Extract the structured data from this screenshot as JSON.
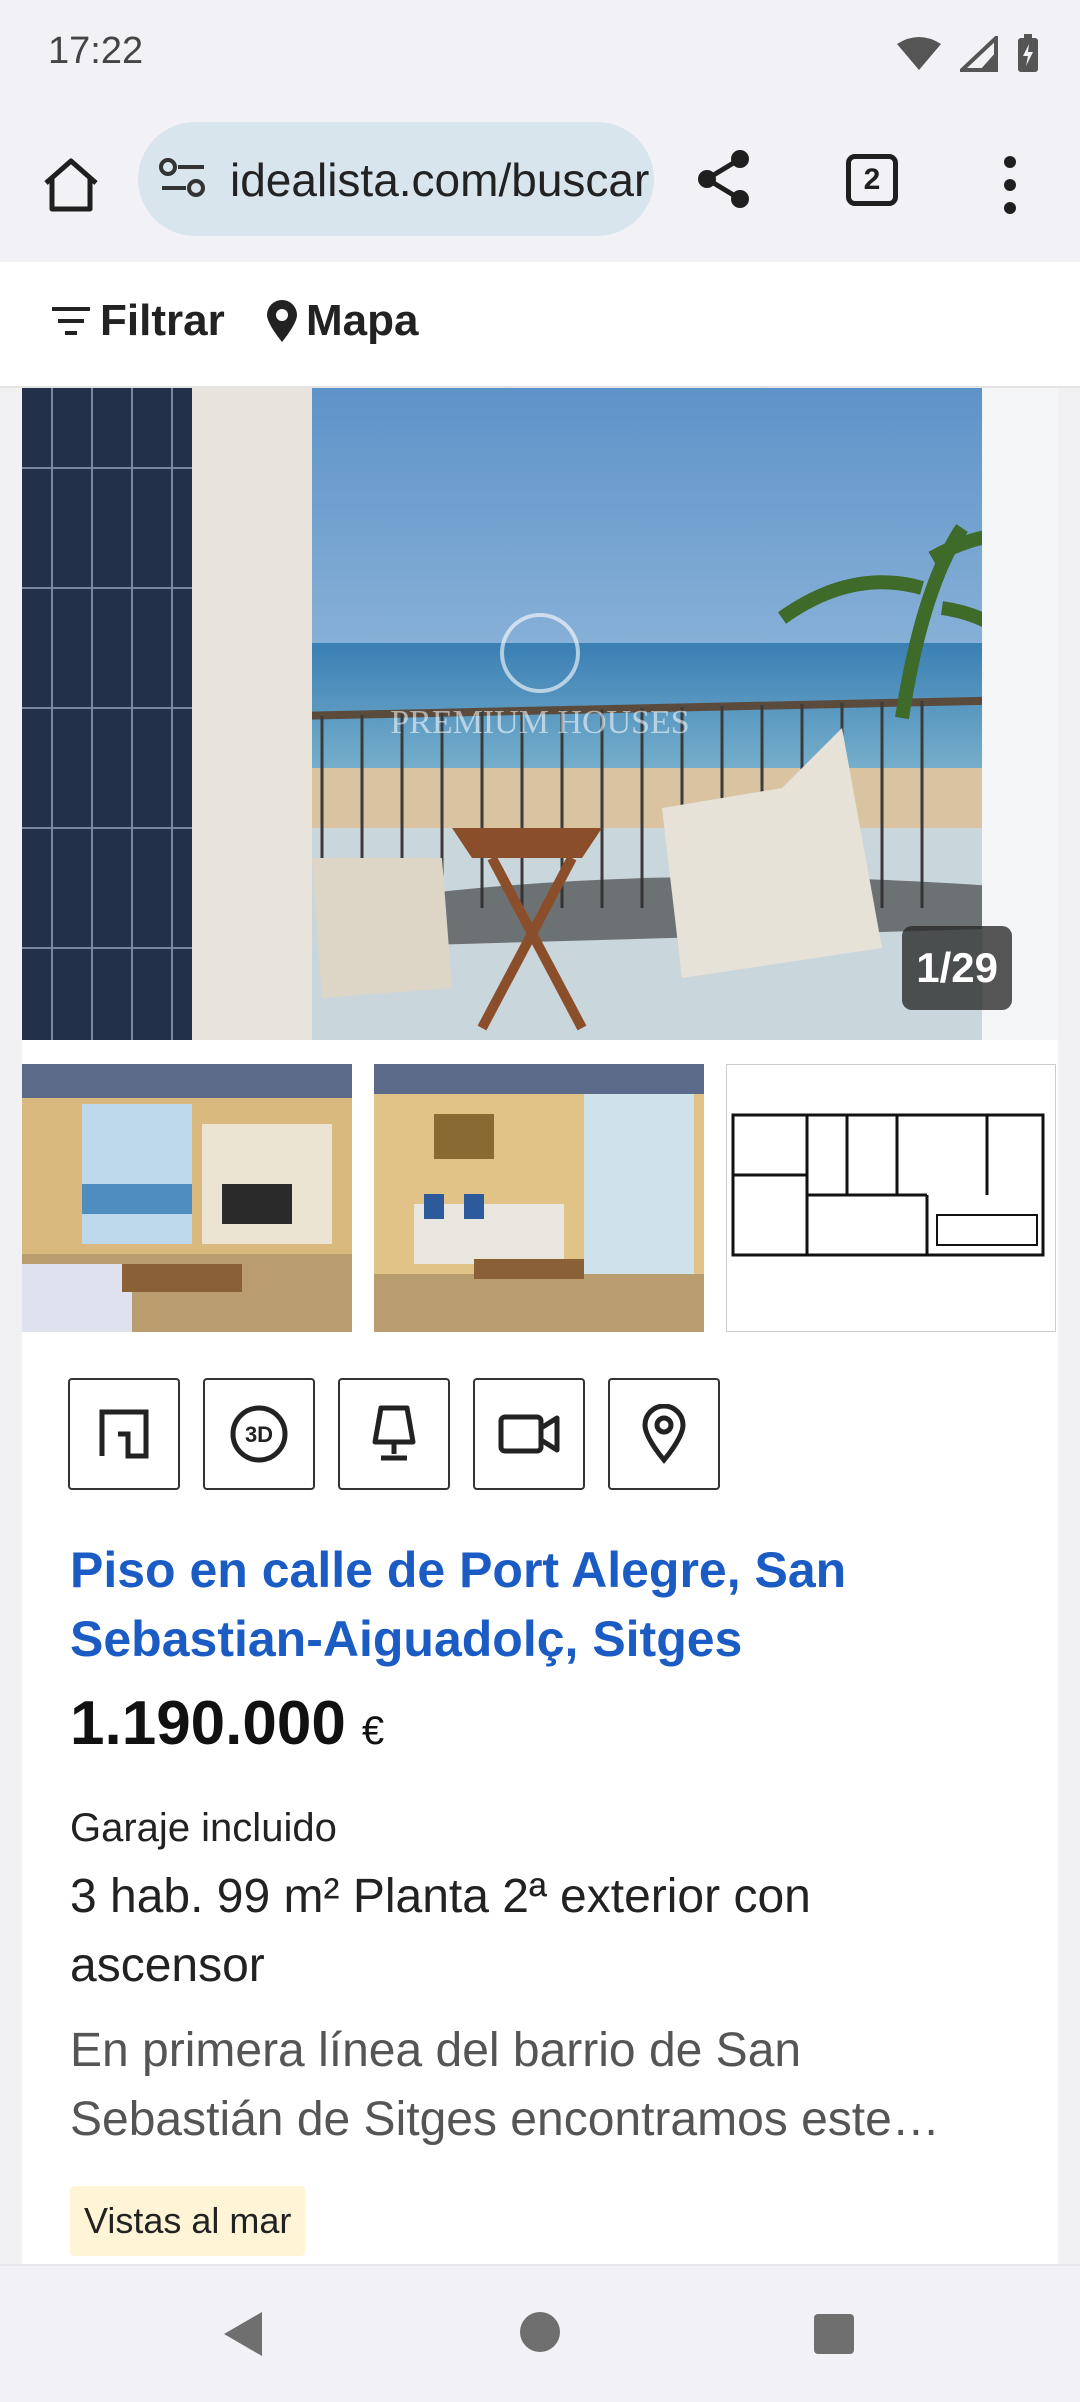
{
  "status": {
    "time": "17:22"
  },
  "browser": {
    "url": "idealista.com/buscar",
    "tab_count": "2"
  },
  "filterbar": {
    "filter_label": "Filtrar",
    "map_label": "Mapa"
  },
  "listing": {
    "photo_counter": "1/29",
    "watermark": "PREMIUM HOUSES",
    "features": [
      "floor-plan-icon",
      "3d-tour-icon",
      "home-staging-icon",
      "video-icon",
      "location-pin-icon"
    ],
    "title": "Piso en calle de Port Alegre, San Sebastian-Aiguadolç, Sitges",
    "price": "1.190.000",
    "currency": "€",
    "garage": "Garaje incluido",
    "details": "3 hab.  99 m²  Planta 2ª exterior con ascensor",
    "description_line1": "En primera línea del barrio de San",
    "description_line2": "Sebastián de Sitges encontramos este…",
    "tag": "Vistas al mar"
  },
  "colors": {
    "title_blue": "#1a5bc4",
    "url_bar": "#d8e5ec",
    "tag_bg": "#fff5d6"
  }
}
